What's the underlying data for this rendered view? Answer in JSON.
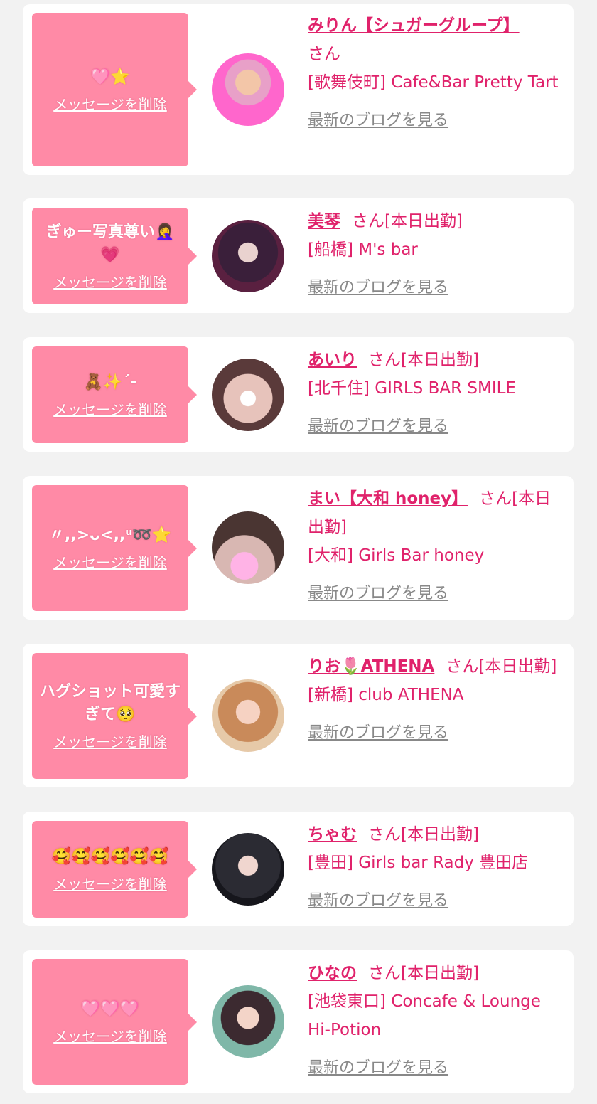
{
  "cards": [
    {
      "message": "🩷⭐",
      "delete_label": "メッセージを削除",
      "name": "みりん【シュガーグループ】",
      "suffix": "さん",
      "shop": "[歌舞伎町] Cafe&Bar Pretty Tart",
      "blog_label": "最新のブログを見る"
    },
    {
      "message": "ぎゅー写真尊い🤦‍♀️💗",
      "delete_label": "メッセージを削除",
      "name": "美琴",
      "suffix": "さん[本日出勤]",
      "shop": "[船橋] M's bar",
      "blog_label": "最新のブログを見る"
    },
    {
      "message": "🧸✨´-",
      "delete_label": "メッセージを削除",
      "name": "あいり",
      "suffix": "さん[本日出勤]",
      "shop": "[北千住] GIRLS BAR SMILE",
      "blog_label": "最新のブログを見る"
    },
    {
      "message": "〃,,>ᴗ<,,ᵘ➿⭐",
      "delete_label": "メッセージを削除",
      "name": "まい【大和 honey】",
      "suffix": "さん[本日出勤]",
      "shop": "[大和] Girls Bar honey",
      "blog_label": "最新のブログを見る"
    },
    {
      "message": "ハグショット可愛すぎて🥺",
      "delete_label": "メッセージを削除",
      "name": "りお🌷ATHENA",
      "suffix": "さん[本日出勤]",
      "shop": "[新橋] club ATHENA",
      "blog_label": "最新のブログを見る"
    },
    {
      "message": "🥰🥰🥰🥰🥰🥰",
      "delete_label": "メッセージを削除",
      "name": "ちゃむ",
      "suffix": "さん[本日出勤]",
      "shop": "[豊田] Girls bar Rady 豊田店",
      "blog_label": "最新のブログを見る"
    },
    {
      "message": "🩷🩷🩷",
      "delete_label": "メッセージを削除",
      "name": "ひなの",
      "suffix": "さん[本日出勤]",
      "shop": "[池袋東口] Concafe & Lounge Hi-Potion",
      "blog_label": "最新のブログを見る"
    }
  ],
  "colors": {
    "accent_pink": "#e0226b",
    "bubble_pink": "#ff8aa6",
    "link_gray": "#888888",
    "page_bg": "#f2f2f2"
  }
}
